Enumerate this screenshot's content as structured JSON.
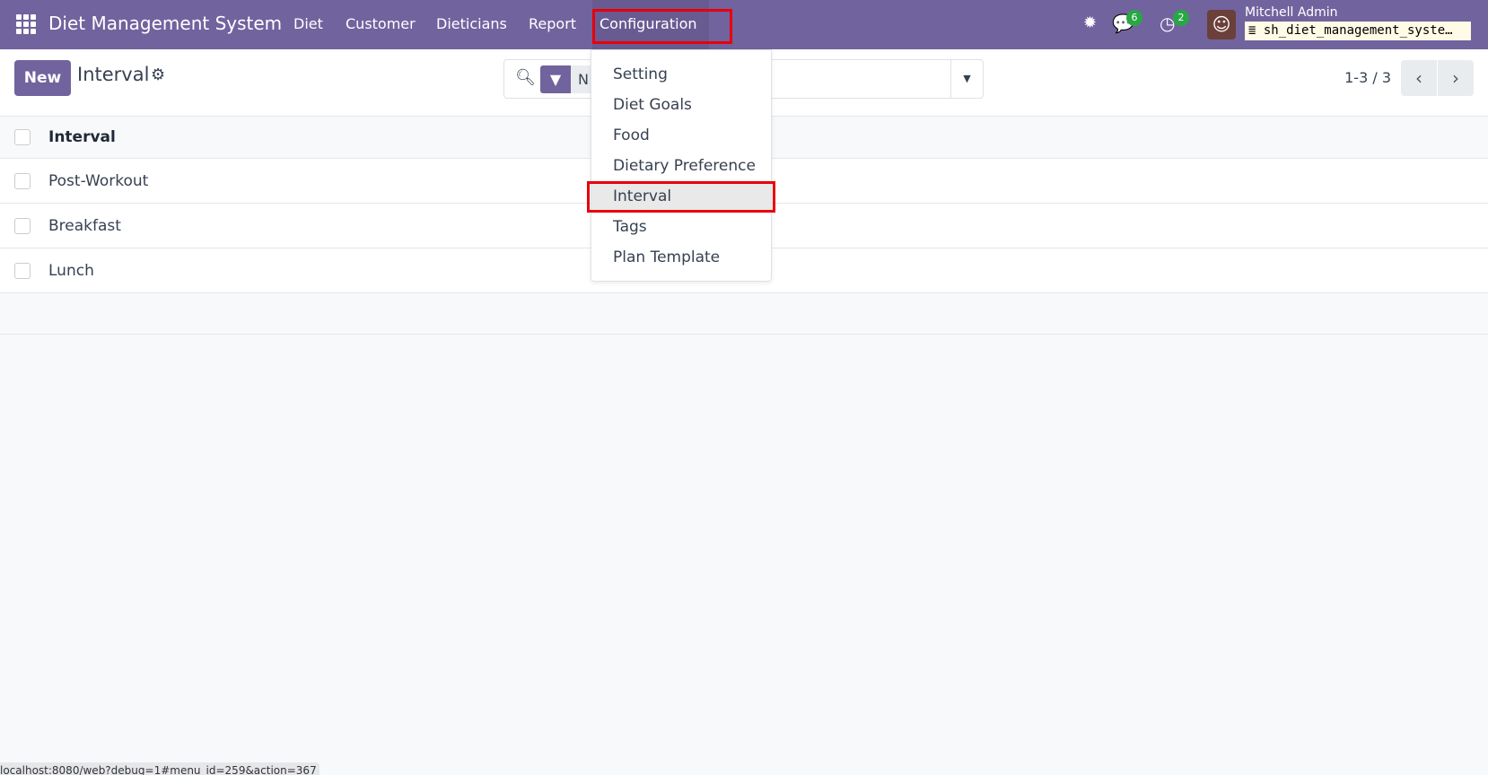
{
  "navbar": {
    "app_name": "Diet Management System",
    "menus": [
      "Diet",
      "Customer",
      "Dieticians",
      "Report",
      "Configuration"
    ],
    "messages_badge": "6",
    "activities_badge": "2",
    "user_name": "Mitchell Admin",
    "database": "sh_diet_management_syste…",
    "accent": "#71639e"
  },
  "control": {
    "new_label": "New",
    "title": "Interval",
    "search_facet_partial": "N",
    "pager": "1-3 / 3"
  },
  "config_menu": {
    "items": [
      "Setting",
      "Diet Goals",
      "Food",
      "Dietary Preference",
      "Interval",
      "Tags",
      "Plan Template"
    ],
    "active": "Interval"
  },
  "table": {
    "header": "Interval",
    "rows": [
      "Post-Workout",
      "Breakfast",
      "Lunch"
    ]
  },
  "status_url": "localhost:8080/web?debug=1#menu_id=259&action=367"
}
